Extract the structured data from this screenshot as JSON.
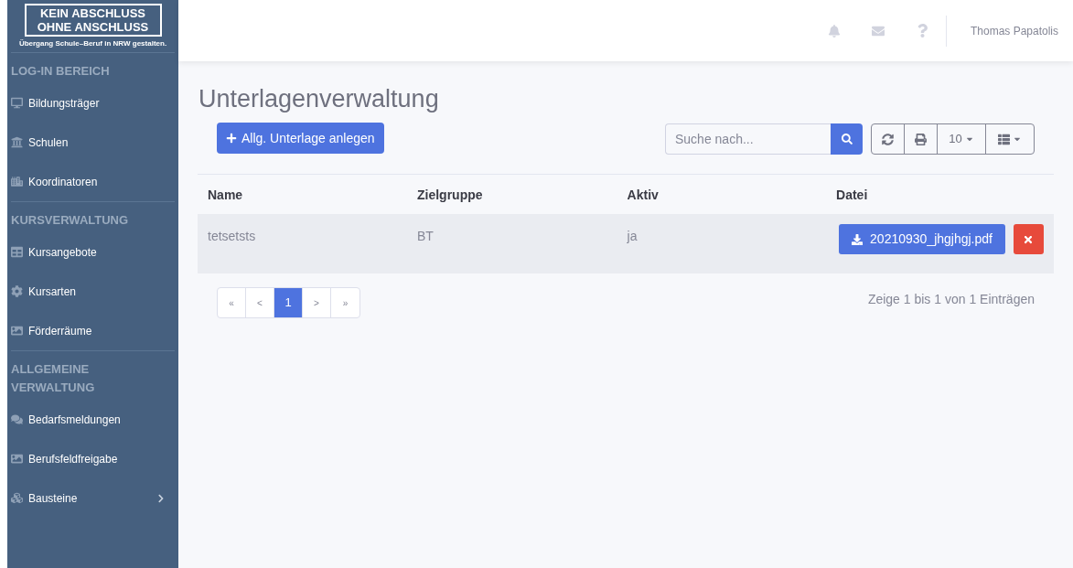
{
  "logo": {
    "line_1": "KEIN ABSCHLUSS",
    "line_2": "OHNE ANSCHLUSS",
    "tagline": "Übergang Schule–Beruf in NRW gestalten."
  },
  "sidebar": {
    "sections": [
      {
        "title": "LOG-IN BEREICH",
        "items": [
          {
            "kind": "monitor",
            "label": "Bildungsträger"
          },
          {
            "kind": "building",
            "label": "Schulen"
          },
          {
            "kind": "city",
            "label": "Koordinatoren"
          }
        ]
      },
      {
        "title": "KURSVERWALTUNG",
        "items": [
          {
            "kind": "table",
            "label": "Kursangebote"
          },
          {
            "kind": "gear",
            "label": "Kursarten"
          },
          {
            "kind": "image",
            "label": "Förderräume"
          }
        ]
      },
      {
        "title": "ALLGEMEINE VERWALTUNG",
        "items": [
          {
            "kind": "chat",
            "label": "Bedarfsmeldungen"
          },
          {
            "kind": "image",
            "label": "Berufsfeldfreigabe"
          },
          {
            "kind": "cubes",
            "label": "Bausteine",
            "has_submenu": true
          }
        ]
      }
    ]
  },
  "header": {
    "user": "Thomas Papatolis"
  },
  "page": {
    "title": "Unterlagenverwaltung",
    "add_button": "Allg. Unterlage anlegen",
    "search": {
      "placeholder": "Suche nach..."
    },
    "page_size": "10"
  },
  "table": {
    "columns": [
      "Name",
      "Zielgruppe",
      "Aktiv",
      "Datei"
    ],
    "rows": [
      {
        "name": "tetsetsts",
        "zielgruppe": "BT",
        "aktiv": "ja",
        "file": "20210930_jhgjhgj.pdf"
      }
    ]
  },
  "pagination": {
    "pages": [
      {
        "label": "«",
        "selected": false
      },
      {
        "label": "<",
        "selected": false
      },
      {
        "label": "1",
        "selected": true
      },
      {
        "label": ">",
        "selected": false
      },
      {
        "label": "»",
        "selected": false
      }
    ],
    "summary": "Zeige 1 bis 1 von 1 Einträgen"
  }
}
